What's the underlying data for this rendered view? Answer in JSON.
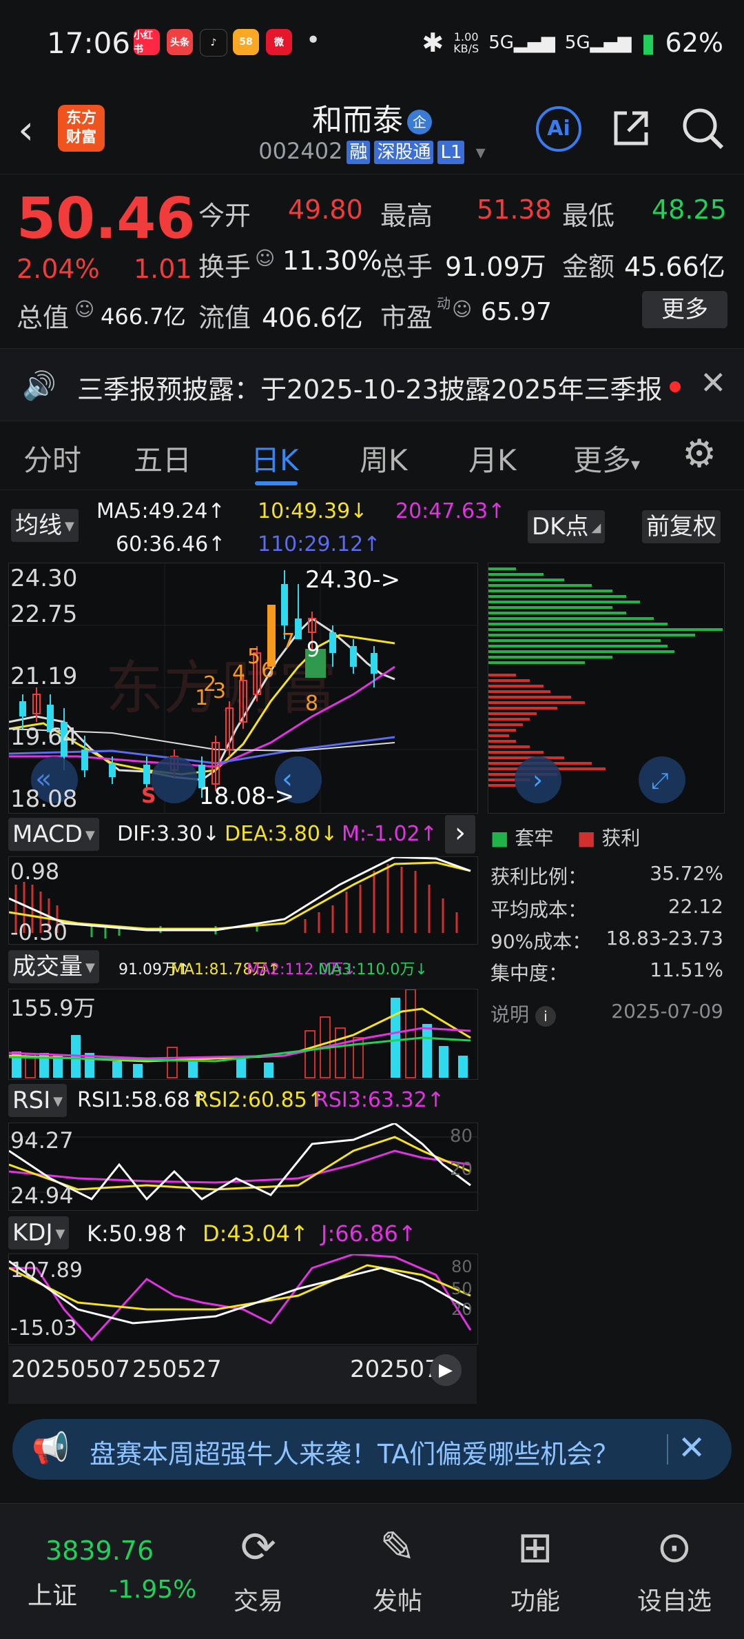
{
  "status": {
    "time": "17:06",
    "apps": [
      {
        "label": "小红书",
        "color": "#ff2741"
      },
      {
        "label": "头条",
        "color": "#f04142"
      },
      {
        "label": "♪",
        "color": "#111111"
      },
      {
        "label": "58",
        "color": "#f9a825"
      },
      {
        "label": "微",
        "color": "#e6162d"
      }
    ],
    "dot": "•",
    "bt": "✱",
    "speed_top": "1.00",
    "speed_bottom": "KB/S",
    "net1": "5G",
    "net2": "5G",
    "battery": "62%"
  },
  "header": {
    "back": "‹",
    "logo_line1": "东方",
    "logo_line2": "财富",
    "name": "和而泰",
    "ent_badge": "企",
    "code": "002402",
    "tags": [
      "融",
      "深股通",
      "L1"
    ],
    "dropdown": "▾",
    "ai": "Ai"
  },
  "quote": {
    "price": "50.46",
    "pct": "2.04%",
    "change": "1.01",
    "open_label": "今开",
    "open": "49.80",
    "high_label": "最高",
    "high": "51.38",
    "low_label": "最低",
    "low": "48.25",
    "turnover_label": "换手",
    "turnover": "11.30%",
    "volume_label": "总手",
    "volume": "91.09万",
    "amount_label": "金额",
    "amount": "45.66亿",
    "mktcap_label": "总值",
    "mktcap": "466.7亿",
    "float_label": "流值",
    "float": "406.6亿",
    "pe_label": "市盈",
    "pe_sup": "动",
    "pe": "65.97",
    "more": "更多"
  },
  "notice": {
    "text": "三季报预披露：于2025-10-23披露2025年三季报",
    "close": "✕"
  },
  "tabs": [
    "分时",
    "五日",
    "日K",
    "周K",
    "月K",
    "更多"
  ],
  "tabs_active": 2,
  "tabs_more_arrow": "▾",
  "ma_bar": {
    "chip": "均线",
    "ma5": "MA5:49.24↑",
    "ma10": "10:49.39↓",
    "ma20": "20:47.63↑",
    "ma60": "60:36.46↑",
    "ma110": "110:29.12↑",
    "dk": "DK点",
    "adj": "前复权"
  },
  "kline": {
    "y_top": "24.30",
    "y2": "22.75",
    "y3": "21.19",
    "y4": "19.64",
    "y_bottom": "18.08",
    "high_mark": "24.30->",
    "low_mark": "18.08->",
    "watermark": "东方财富",
    "signal_s": "S",
    "signal_nums": [
      "1",
      "2",
      "3",
      "4",
      "5",
      "6",
      "7",
      "8",
      "9"
    ]
  },
  "macd": {
    "chip": "MACD",
    "dif": "DIF:3.30↓",
    "dea": "DEA:3.80↓",
    "m": "M:-1.02↑",
    "y_top": "0.98",
    "y_bottom": "-0.30"
  },
  "vol": {
    "chip": "成交量",
    "v": "91.09万↑",
    "ma1": "MA1:81.78万↑",
    "ma2": "MA2:112.0万↓",
    "ma3": "MA3:110.0万↓",
    "y_top": "155.9万"
  },
  "rsi": {
    "chip": "RSI",
    "r1": "RSI1:58.68↑",
    "r2": "RSI2:60.85↑",
    "r3": "RSI3:63.32↑",
    "y_top": "94.27",
    "y_bottom": "24.94",
    "r80": "80",
    "r20": "20"
  },
  "kdj": {
    "chip": "KDJ",
    "k": "K:50.98↑",
    "d": "D:43.04↑",
    "j": "J:66.86↑",
    "y_top": "107.89",
    "y_bottom": "-15.03",
    "r80": "80",
    "r50": "50",
    "r20": "20"
  },
  "dates": {
    "d1": "20250507",
    "d2": "250527",
    "d3": "202507"
  },
  "chips_panel": {
    "legend_trap": "套牢",
    "legend_profit": "获利",
    "profit_ratio_label": "获利比例：",
    "profit_ratio": "35.72%",
    "avg_cost_label": "平均成本：",
    "avg_cost": "22.12",
    "cost90_label": "90%成本：",
    "cost90": "18.83-23.73",
    "concentration_label": "集中度：",
    "concentration": "11.51%",
    "note_label": "说明",
    "note_icon": "i",
    "note_date": "2025-07-09"
  },
  "ad": {
    "text": "盘赛本周超强牛人来袭！TA们偏爱哪些机会？",
    "close": "✕"
  },
  "bottom": {
    "index_value": "3839.76",
    "index_name": "上证",
    "index_pct": "-1.95%",
    "items": [
      "交易",
      "发帖",
      "功能",
      "设自选"
    ]
  }
}
